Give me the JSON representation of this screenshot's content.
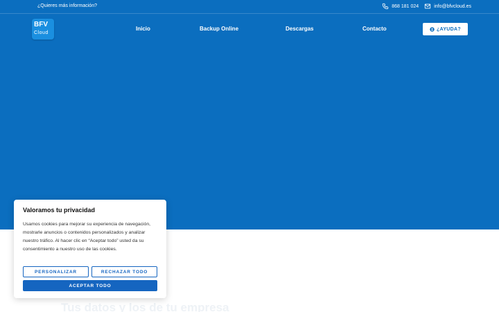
{
  "topbar": {
    "info_text": "¿Quieres más información?",
    "phone": "868 181 024",
    "email": "info@bfvcloud.es"
  },
  "logo": {
    "line1": "BFV",
    "line2": "Cloud"
  },
  "nav": {
    "items": [
      "Inicio",
      "Backup Online",
      "Descargas",
      "Contacto"
    ]
  },
  "help_button": {
    "label": "¿AYUDA?"
  },
  "hero": {
    "background": "#0b6ebf"
  },
  "faded_heading": "Tus datos y los de tu empresa",
  "cookie_banner": {
    "title": "Valoramos tu privacidad",
    "body": "Usamos cookies para mejorar su experiencia de navegación, mostrarle anuncios o contenidos personalizados y analizar nuestro tráfico. Al hacer clic en “Aceptar todo” usted da su consentimiento a nuestro uso de las cookies.",
    "customize_label": "PERSONALIZAR",
    "reject_label": "RECHAZAR TODO",
    "accept_label": "ACEPTAR TODO"
  }
}
